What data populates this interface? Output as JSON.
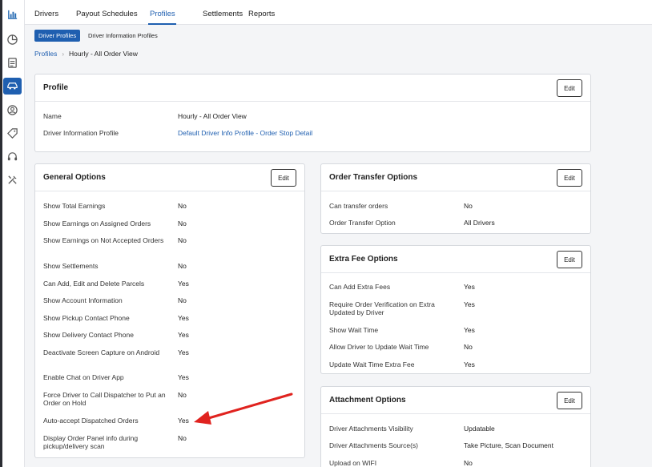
{
  "nav": {
    "tabs": [
      {
        "label": "Drivers"
      },
      {
        "label": "Payout Schedules"
      },
      {
        "label": "Profiles"
      },
      {
        "label": "Settlements"
      },
      {
        "label": "Reports"
      }
    ],
    "active_tab": "Profiles"
  },
  "subnav": {
    "driver_profiles": "Driver Profiles",
    "driver_information_profiles": "Driver Information Profiles"
  },
  "breadcrumb": {
    "root": "Profiles",
    "current": "Hourly - All Order View"
  },
  "rail_icons": [
    "logo-icon",
    "pie-chart-icon",
    "document-icon",
    "vehicle-icon",
    "user-circle-icon",
    "tag-icon",
    "headset-icon",
    "tools-icon"
  ],
  "profile": {
    "title": "Profile",
    "edit_label": "Edit",
    "rows": [
      {
        "label": "Name",
        "value": "Hourly - All Order View"
      },
      {
        "label": "Driver Information Profile",
        "value": "Default Driver Info Profile - Order Stop Detail"
      }
    ]
  },
  "general_options": {
    "title": "General Options",
    "edit_label": "Edit",
    "rows": [
      {
        "label": "Show Total Earnings",
        "value": "No"
      },
      {
        "label": "Show Earnings on Assigned Orders",
        "value": "No"
      },
      {
        "label": "Show Earnings on Not Accepted Orders",
        "value": "No"
      },
      {
        "label": "Show Settlements",
        "value": "No"
      },
      {
        "label": "Can Add, Edit and Delete Parcels",
        "value": "Yes"
      },
      {
        "label": "Show Account Information",
        "value": "No"
      },
      {
        "label": "Show Pickup Contact Phone",
        "value": "Yes"
      },
      {
        "label": "Show Delivery Contact Phone",
        "value": "Yes"
      },
      {
        "label": "Deactivate Screen Capture on Android",
        "value": "Yes"
      },
      {
        "label": "Enable Chat on Driver App",
        "value": "Yes"
      },
      {
        "label": "Force Driver to Call Dispatcher to Put an Order on Hold",
        "value": "No"
      },
      {
        "label": "Auto-accept Dispatched Orders",
        "value": "Yes"
      },
      {
        "label": "Display Order Panel info during pickup/delivery scan",
        "value": "No"
      }
    ]
  },
  "order_transfer_options": {
    "title": "Order Transfer Options",
    "edit_label": "Edit",
    "rows": [
      {
        "label": "Can transfer orders",
        "value": "No"
      },
      {
        "label": "Order Transfer Option",
        "value": "All Drivers"
      }
    ]
  },
  "extra_fee_options": {
    "title": "Extra Fee Options",
    "edit_label": "Edit",
    "rows": [
      {
        "label": "Can Add Extra Fees",
        "value": "Yes"
      },
      {
        "label": "Require Order Verification on Extra Updated by Driver",
        "value": "Yes"
      },
      {
        "label": "Show Wait Time",
        "value": "Yes"
      },
      {
        "label": "Allow Driver to Update Wait Time",
        "value": "No"
      },
      {
        "label": "Update Wait Time Extra Fee",
        "value": "Yes"
      }
    ]
  },
  "attachment_options": {
    "title": "Attachment Options",
    "edit_label": "Edit",
    "rows": [
      {
        "label": "Driver Attachments Visibility",
        "value": "Updatable"
      },
      {
        "label": "Driver Attachments Source(s)",
        "value": "Take Picture, Scan Document"
      },
      {
        "label": "Upload on WIFI",
        "value": "No"
      }
    ]
  },
  "colors": {
    "accent": "#1f5fb0",
    "annotation_arrow": "#e0231f"
  }
}
